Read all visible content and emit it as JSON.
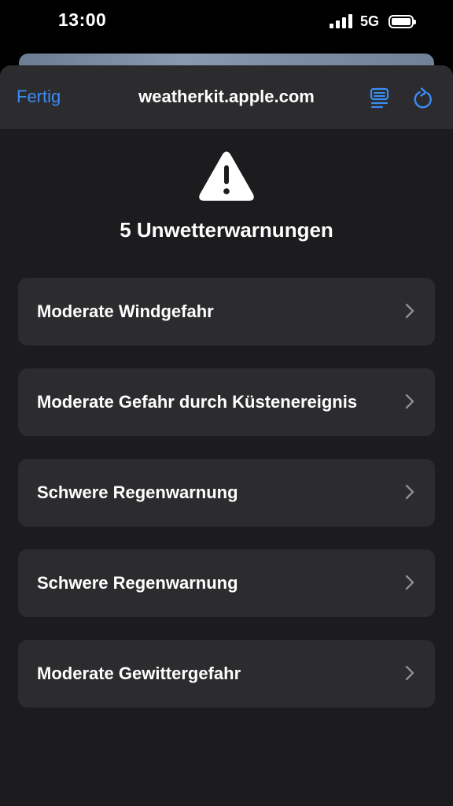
{
  "status_bar": {
    "time": "13:00",
    "network": "5G",
    "icons": [
      "signal-icon",
      "battery-icon"
    ]
  },
  "nav": {
    "done_label": "Fertig",
    "title": "weatherkit.apple.com",
    "icons": [
      "reader-icon",
      "reload-icon"
    ]
  },
  "content": {
    "icon": "warning-triangle-icon",
    "heading": "5 Unwetterwarnungen",
    "alerts": [
      {
        "label": "Moderate Windgefahr"
      },
      {
        "label": "Moderate Gefahr durch Küstenereignis"
      },
      {
        "label": "Schwere Regenwarnung"
      },
      {
        "label": "Schwere Regenwarnung"
      },
      {
        "label": "Moderate Gewittergefahr"
      }
    ]
  },
  "colors": {
    "accent": "#3a8cf5",
    "sheet_background": "#1c1c1e",
    "card_background": "#2c2c2e",
    "chevron": "#8e8e93"
  }
}
